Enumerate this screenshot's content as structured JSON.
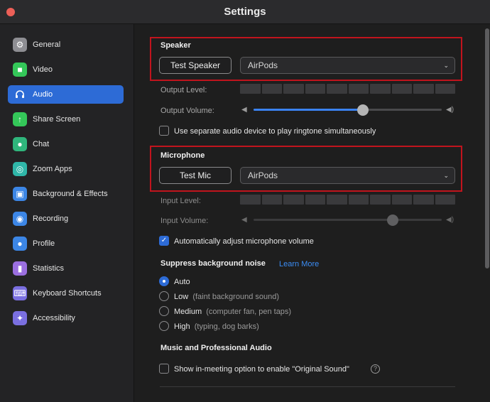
{
  "window": {
    "title": "Settings"
  },
  "sidebar": {
    "items": [
      {
        "label": "General",
        "icon": "gear-icon",
        "color": "#8e8e93",
        "active": false
      },
      {
        "label": "Video",
        "icon": "video-camera-icon",
        "color": "#34c759",
        "active": false
      },
      {
        "label": "Audio",
        "icon": "headphones-icon",
        "color": "#2d6bd6",
        "active": true
      },
      {
        "label": "Share Screen",
        "icon": "share-screen-icon",
        "color": "#34c759",
        "active": false
      },
      {
        "label": "Chat",
        "icon": "chat-bubble-icon",
        "color": "#2fb67c",
        "active": false
      },
      {
        "label": "Zoom Apps",
        "icon": "apps-icon",
        "color": "#2fb6a8",
        "active": false
      },
      {
        "label": "Background & Effects",
        "icon": "background-person-icon",
        "color": "#3c86e6",
        "active": false
      },
      {
        "label": "Recording",
        "icon": "record-icon",
        "color": "#3c86e6",
        "active": false
      },
      {
        "label": "Profile",
        "icon": "person-icon",
        "color": "#3c86e6",
        "active": false
      },
      {
        "label": "Statistics",
        "icon": "bar-chart-icon",
        "color": "#9b6fe0",
        "active": false
      },
      {
        "label": "Keyboard Shortcuts",
        "icon": "keyboard-icon",
        "color": "#7a6fe0",
        "active": false
      },
      {
        "label": "Accessibility",
        "icon": "accessibility-icon",
        "color": "#7a6fe0",
        "active": false
      }
    ]
  },
  "speaker": {
    "title": "Speaker",
    "test_button": "Test Speaker",
    "device": "AirPods",
    "output_level_label": "Output Level:",
    "output_volume_label": "Output Volume:",
    "output_volume": 0.58
  },
  "separate_ringtone": {
    "label": "Use separate audio device to play ringtone simultaneously",
    "checked": false
  },
  "microphone": {
    "title": "Microphone",
    "test_button": "Test Mic",
    "device": "AirPods",
    "input_level_label": "Input Level:",
    "input_volume_label": "Input Volume:",
    "input_volume": 0.74
  },
  "auto_adjust": {
    "label": "Automatically adjust microphone volume",
    "checked": true
  },
  "suppress": {
    "title": "Suppress background noise",
    "learn_more": "Learn More",
    "options": [
      {
        "label": "Auto",
        "hint": "",
        "checked": true
      },
      {
        "label": "Low",
        "hint": "(faint background sound)",
        "checked": false
      },
      {
        "label": "Medium",
        "hint": "(computer fan, pen taps)",
        "checked": false
      },
      {
        "label": "High",
        "hint": "(typing, dog barks)",
        "checked": false
      }
    ]
  },
  "music": {
    "title": "Music and Professional Audio",
    "original_sound_label": "Show in-meeting option to enable \"Original Sound\"",
    "checked": false
  },
  "colors": {
    "accent": "#2d6bd6",
    "highlight": "#c1141d"
  }
}
